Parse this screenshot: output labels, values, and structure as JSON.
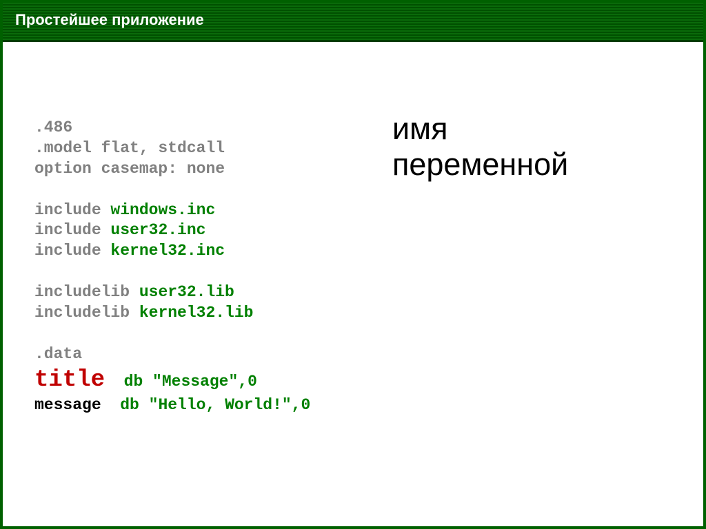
{
  "header": {
    "title": "Простейшее приложение"
  },
  "annotation": "имя\nпеременной",
  "code": {
    "l1": ".486",
    "l2": ".model flat, stdcall",
    "l3": "option casemap: none",
    "blank1": "",
    "l4_kw": "include",
    "l4_arg": " windows.inc",
    "l5_kw": "include",
    "l5_arg": " user32.inc",
    "l6_kw": "include",
    "l6_arg": " kernel32.inc",
    "blank2": "",
    "l7_kw": "includelib",
    "l7_arg": " user32.lib",
    "l8_kw": "includelib",
    "l8_arg": " kernel32.lib",
    "blank3": "",
    "l9": ".data",
    "l10_name": "title",
    "l10_gap": "  ",
    "l10_type": "db",
    "l10_val": " \"Message\",0",
    "l11_name": "message",
    "l11_gap": "  ",
    "l11_type": "db",
    "l11_val": " \"Hello, World!\",0"
  }
}
